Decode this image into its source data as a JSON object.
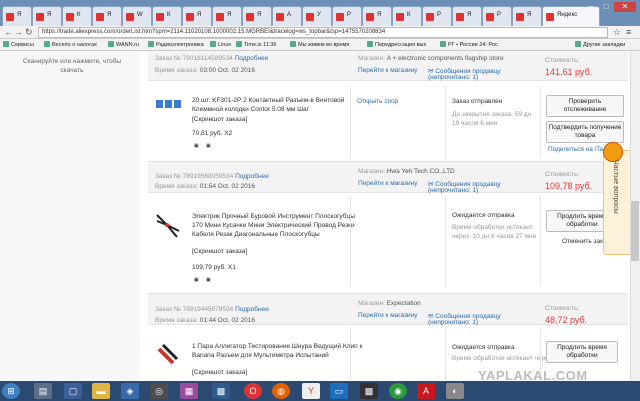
{
  "browser": {
    "tabs": [
      "Я",
      "Я",
      "К",
      "Я",
      "W",
      "К",
      "Я",
      "Я",
      "Я",
      "А",
      "У",
      "Р",
      "Я",
      "К",
      "Р",
      "Я",
      "Р",
      "Я",
      "Яндекс"
    ],
    "window_controls": {
      "minimize": "–",
      "maximize": "□",
      "close": "✕"
    },
    "url": "https://trade.aliexpress.com/orderList.htm?spm=2114.11020108.1000002.15.MGRBEI&tracelog=ws_topbar&tsp=1475570208834",
    "bookmarks": [
      "Сервисы",
      "Весело о налогах",
      "WANN.ru",
      "Радиоэлектроника",
      "Linux",
      "Time.is 11:36",
      "Мы живем во время",
      "Передрессация вых",
      "РГ • России 24: Рос",
      "Другие закладки"
    ]
  },
  "left_panel": {
    "scan_text": "Сканируйте или нажмите, чтобы скачать"
  },
  "orders": [
    {
      "order_label": "Заказ №",
      "order_no": "79016114589534",
      "details_link": "Подробнее",
      "time_label": "Время заказа:",
      "time": "03:00 Oct. 02 2016",
      "store_label": "Магазин:",
      "store": "A + electronic components flagship store",
      "goto_store": "Перейти к магазину",
      "message": "Сообщения продавцу",
      "unread": "(непрочитано: 1)",
      "cost_label": "Стоимость:",
      "cost": "141,61 руб.",
      "item_title": "20 шт. KF301-2P 2 Контактный Разъем-в Винтовой Клеммной колодки Contor 5.08 мм Шаг",
      "screenshot": "[Скриншот заказа]",
      "price_qty": "70,81 руб. X2",
      "action": "Открыть спор",
      "status": "Заказ отправлен",
      "status_note": "До закрытия заказа: 59 дн 19 часов 6 мин",
      "btn1": "Проверить отслеживание",
      "btn2": "Подтвердить получение товара",
      "share": "Поделиться на iTa..."
    },
    {
      "order_label": "Заказ №",
      "order_no": "78919568059534",
      "details_link": "Подробнее",
      "time_label": "Время заказа:",
      "time": "01:54 Oct. 02 2016",
      "store_label": "Магазин:",
      "store": "Hwa Yeh Tech CO.,LTD",
      "goto_store": "Перейти к магазину",
      "message": "Сообщения продавцу",
      "unread": "(непрочитано: 1)",
      "cost_label": "Стоимость:",
      "cost": "109,78 руб.",
      "item_title": "Электрик Прочный Буровой Инструмент Плоскогубцы 170 Мини Кусачки Мини Электрический Провод Резки Кабеля Резак Диагональные Плоскогубцы",
      "screenshot": "[Скриншот заказа]",
      "price_qty": "109,79 руб. X1",
      "status": "Ожидается отправка",
      "status_note": "Время обработки истекает через: 10 дн 6 часов 27 мин",
      "btn1": "Продлить время обработки",
      "cancel": "Отменить заказ"
    },
    {
      "order_label": "Заказ №",
      "order_no": "78919445979534",
      "details_link": "Подробнее",
      "time_label": "Время заказа:",
      "time": "01:44 Oct. 02 2016",
      "store_label": "Магазин:",
      "store": "Expectation",
      "goto_store": "Перейти к магазину",
      "message": "Сообщения продавцу",
      "unread": "(непрочитано: 1)",
      "cost_label": "Стоимость:",
      "cost": "48,72 руб.",
      "item_title": "1 Пара Аллигатор Тестирование Шнура Ведущий Клип к Banana Разъем для Мультиметра Испытаний",
      "screenshot": "[Скриншот заказа]",
      "status": "Ожидается отправка",
      "status_note": "Время обработки истекает через...",
      "btn1": "Продлить время обработки"
    }
  ],
  "chat_widget": {
    "label": "Частые вопросы"
  },
  "watermark": "YAPLAKAL.COM",
  "colors": {
    "accent_red": "#e4393c",
    "link_blue": "#2b6cb0",
    "taskbar": "#2b4a72"
  }
}
